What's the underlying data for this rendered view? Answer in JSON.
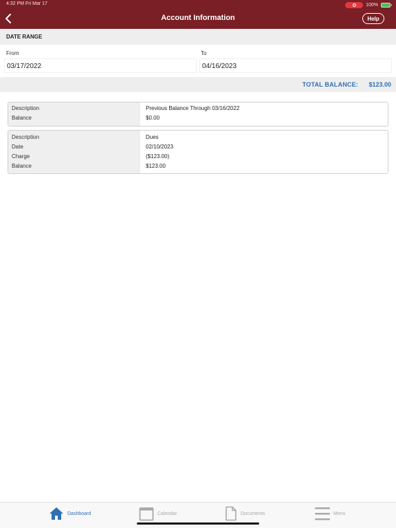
{
  "status_bar": {
    "time": "4:32 PM  Fri Mar 17",
    "battery": "100%"
  },
  "nav": {
    "title": "Account Information",
    "help_label": "Help"
  },
  "date_range": {
    "title": "DATE RANGE",
    "from_label": "From",
    "from_value": "03/17/2022",
    "to_label": "To",
    "to_value": "04/16/2023"
  },
  "total": {
    "label": "TOTAL BALANCE:",
    "value": "$123.00"
  },
  "transactions": [
    {
      "rows": [
        {
          "label": "Description",
          "value": "Previous Balance Through 03/16/2022"
        },
        {
          "label": "Balance",
          "value": "$0.00"
        }
      ]
    },
    {
      "rows": [
        {
          "label": "Description",
          "value": "Dues"
        },
        {
          "label": "Date",
          "value": "02/10/2023"
        },
        {
          "label": "Charge",
          "value": "($123.00)"
        },
        {
          "label": "Balance",
          "value": "$123.00"
        }
      ]
    }
  ],
  "tabs": [
    {
      "label": "Dashboard",
      "icon": "home-icon",
      "active": true
    },
    {
      "label": "Calendar",
      "icon": "calendar-icon",
      "active": false
    },
    {
      "label": "Documents",
      "icon": "document-icon",
      "active": false
    },
    {
      "label": "Menu",
      "icon": "menu-icon",
      "active": false
    }
  ],
  "colors": {
    "header": "#7a1f25",
    "accent": "#2f6fb5",
    "inactive_tab": "#a8a8a8"
  }
}
